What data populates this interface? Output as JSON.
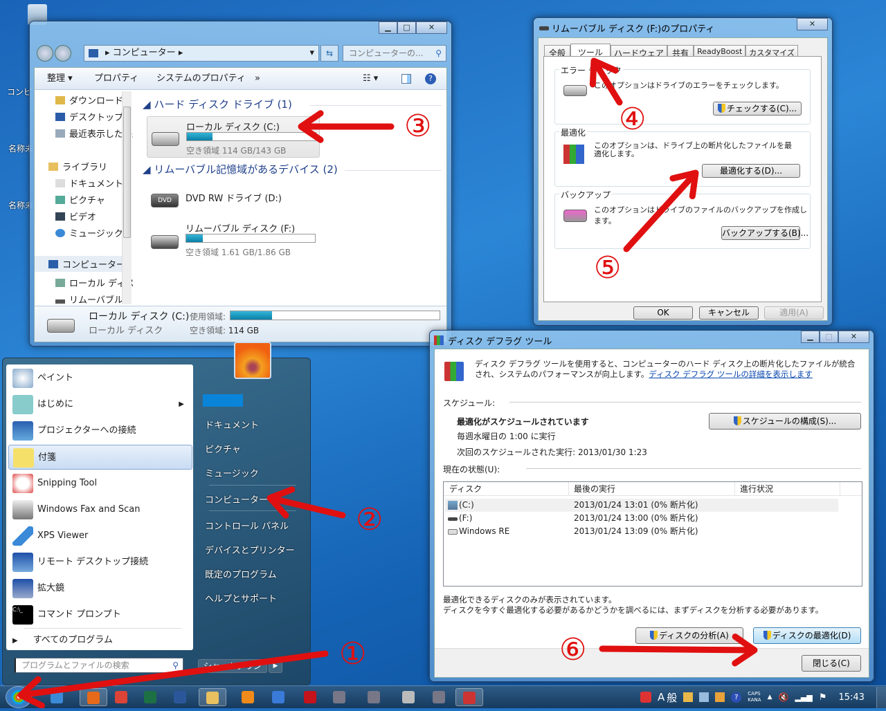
{
  "desktop": {
    "icons": [
      "コンピ",
      "名称未",
      "名称未"
    ]
  },
  "explorer": {
    "address": "コンピューター",
    "search_placeholder": "コンピューターの...",
    "toolbar": {
      "organize": "整理 ▾",
      "properties": "プロパティ",
      "system_properties": "システムのプロパティ",
      "more": "»"
    },
    "nav": [
      "ダウンロード",
      "デスクトップ",
      "最近表示した場所",
      "ライブラリ",
      "ドキュメント",
      "ピクチャ",
      "ビデオ",
      "ミュージック",
      "コンピューター",
      "ローカル ディスク",
      "リムーバブル"
    ],
    "groups": {
      "hdd": "ハード ディスク ドライブ (1)",
      "removable": "リムーバブル記憶域があるデバイス (2)"
    },
    "drives": [
      {
        "name": "ローカル ディスク (C:)",
        "free": "空き領域 114 GB/143 GB",
        "used_fraction": 0.2
      },
      {
        "name": "DVD RW ドライブ (D:)",
        "badge": "DVD"
      },
      {
        "name": "リムーバブル ディスク (F:)",
        "free": "空き領域 1.61 GB/1.86 GB",
        "used_fraction": 0.13
      }
    ],
    "details": {
      "name": "ローカル ディスク (C:)",
      "type": "ローカル ディスク",
      "used_label": "使用領域:",
      "free_label": "空き領域:",
      "free_value": "114 GB",
      "used_fraction": 0.2
    }
  },
  "properties": {
    "title": "リムーバブル ディスク (F:)のプロパティ",
    "tabs": [
      "全般",
      "ツール",
      "ハードウェア",
      "共有",
      "ReadyBoost",
      "カスタマイズ"
    ],
    "active_tab": "ツール",
    "error": {
      "label": "エラー チェック",
      "text": "このオプションはドライブのエラーをチェックします。",
      "button": "チェックする(C)..."
    },
    "defrag": {
      "label": "最適化",
      "text": "このオプションは、ドライブ上の断片化したファイルを最適化します。",
      "button": "最適化する(D)..."
    },
    "backup": {
      "label": "バックアップ",
      "text": "このオプションはドライブのファイルのバックアップを作成します。",
      "button": "バックアップする(B)..."
    },
    "ok": "OK",
    "cancel": "キャンセル",
    "apply": "適用(A)"
  },
  "defrag": {
    "title": "ディスク デフラグ ツール",
    "intro": "ディスク デフラグ ツールを使用すると、コンピューターのハード ディスク上の断片化したファイルが統合され、システムのパフォーマンスが向上します。",
    "link": "ディスク デフラグ ツールの詳細を表示します",
    "schedule_label": "スケジュール:",
    "schedule_status": "最適化がスケジュールされています",
    "schedule_freq": "毎週水曜日の 1:00 に実行",
    "schedule_next": "次回のスケジュールされた実行: 2013/01/30 1:23",
    "schedule_button": "スケジュールの構成(S)...",
    "status_label": "現在の状態(U):",
    "columns": [
      "ディスク",
      "最後の実行",
      "進行状況"
    ],
    "rows": [
      {
        "disk": "(C:)",
        "last": "2013/01/24 13:01 (0% 断片化)",
        "progress": ""
      },
      {
        "disk": "(F:)",
        "last": "2013/01/24 13:00 (0% 断片化)",
        "progress": ""
      },
      {
        "disk": "Windows RE",
        "last": "2013/01/24 13:09 (0% 断片化)",
        "progress": ""
      }
    ],
    "note1": "最適化できるディスクのみが表示されています。",
    "note2": "ディスクを今すぐ最適化する必要があるかどうかを調べるには、まずディスクを分析する必要があります。",
    "analyze": "ディスクの分析(A)",
    "optimize": "ディスクの最適化(D)",
    "close": "閉じる(C)"
  },
  "start_menu": {
    "programs": [
      "ペイント",
      "はじめに",
      "プロジェクターへの接続",
      "付箋",
      "Snipping Tool",
      "Windows Fax and Scan",
      "XPS Viewer",
      "リモート デスクトップ接続",
      "拡大鏡",
      "コマンド プロンプト"
    ],
    "all_programs": "すべてのプログラム",
    "search_placeholder": "プログラムとファイルの検索",
    "right": [
      "ドキュメント",
      "ピクチャ",
      "ミュージック",
      "コンピューター",
      "コントロール パネル",
      "デバイスとプリンター",
      "既定のプログラム",
      "ヘルプとサポート"
    ],
    "shutdown": "シャットダウン"
  },
  "taskbar": {
    "apps": [
      "internet-explorer",
      "firefox",
      "chrome",
      "excel",
      "word",
      "explorer",
      "media-player",
      "itunes",
      "acrobat",
      "app",
      "app",
      "calculator",
      "app",
      "defrag"
    ],
    "tray": {
      "ime_a": "A",
      "ime_mode": "般",
      "caps": "CAPS",
      "kana": "KANA",
      "time": "15:43"
    }
  },
  "annotations": [
    "①",
    "②",
    "③",
    "④",
    "⑤",
    "⑥"
  ],
  "colors": {
    "annotation": "#e01010",
    "accent": "#1d6fb8"
  }
}
